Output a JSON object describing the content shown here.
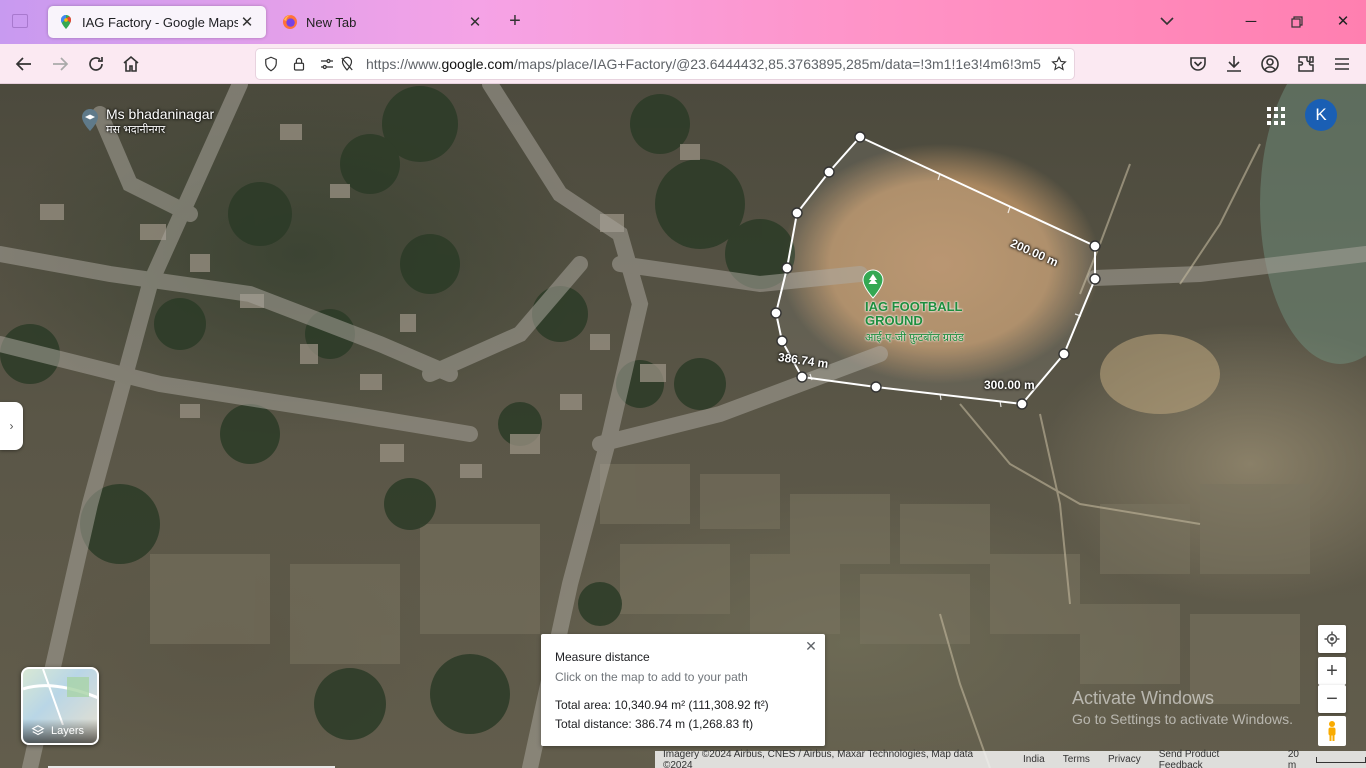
{
  "browser": {
    "tabs": [
      {
        "title": "IAG Factory - Google Maps",
        "active": true,
        "icon": "google-maps-pin-icon"
      },
      {
        "title": "New Tab",
        "active": false,
        "icon": "firefox-icon"
      }
    ],
    "url": {
      "prefix": "https://www.",
      "domain": "google.com",
      "path": "/maps/place/IAG+Factory/@23.6444432,85.3763895,285m/data=!3m1!1e3!4m6!3m5"
    }
  },
  "map": {
    "place_label": "Ms bhadaninagar",
    "place_label_local": "मस भदानीनगर",
    "poi_title_line1": "IAG FOOTBALL",
    "poi_title_line2": "GROUND",
    "poi_subtitle": "आई-ए-जी फ़ुटबॉल ग्राउंड",
    "measure_labels": {
      "top": "200.00 m",
      "bottom": "300.00 m",
      "total": "386.74 m"
    },
    "avatar_letter": "K",
    "layers_label": "Layers"
  },
  "measure": {
    "title": "Measure distance",
    "hint": "Click on the map to add to your path",
    "area": "Total area: 10,340.94 m² (111,308.92 ft²)",
    "distance": "Total distance: 386.74 m (1,268.83 ft)"
  },
  "watermark": {
    "line1": "Activate Windows",
    "line2": "Go to Settings to activate Windows."
  },
  "footer": {
    "imagery": "Imagery ©2024 Airbus, CNES / Airbus, Maxar Technologies, Map data ©2024",
    "india": "India",
    "terms": "Terms",
    "privacy": "Privacy",
    "feedback": "Send Product Feedback",
    "scale": "20 m"
  }
}
